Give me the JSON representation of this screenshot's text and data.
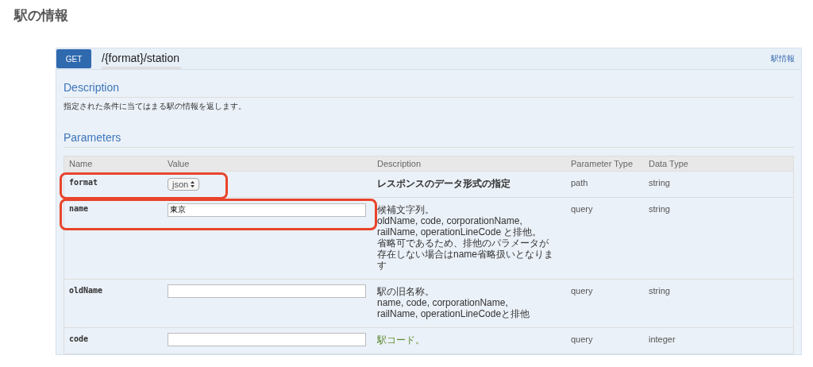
{
  "page_title": "駅の情報",
  "operation": {
    "method": "GET",
    "path": "/{format}/station",
    "tag": "駅情報",
    "description_heading": "Description",
    "description": "指定された条件に当てはまる駅の情報を返します。",
    "parameters_heading": "Parameters",
    "columns": [
      "Name",
      "Value",
      "Description",
      "Parameter Type",
      "Data Type"
    ],
    "parameters": [
      {
        "name": "format",
        "kind": "select",
        "value": "json",
        "description": [
          "レスポンスのデータ形式の指定"
        ],
        "bold": true,
        "link": false,
        "param_type": "path",
        "data_type": "string",
        "highlighted": true
      },
      {
        "name": "name",
        "kind": "text",
        "value": "東京",
        "description": [
          "候補文字列。",
          "oldName, code, corporationName,",
          "railName, operationLineCode と排他。",
          "省略可であるため、排他のパラメータが",
          "存在しない場合はname省略扱いとなりま",
          "す"
        ],
        "bold": false,
        "link": false,
        "param_type": "query",
        "data_type": "string",
        "highlighted": true
      },
      {
        "name": "oldName",
        "kind": "text",
        "description": [
          "駅の旧名称。",
          "name, code, corporationName,",
          "railName, operationLineCodeと排他"
        ],
        "bold": false,
        "link": false,
        "param_type": "query",
        "data_type": "string",
        "highlighted": false
      },
      {
        "name": "code",
        "kind": "text",
        "description": [
          "駅コード。"
        ],
        "bold": false,
        "link": true,
        "param_type": "query",
        "data_type": "integer",
        "highlighted": false
      }
    ]
  }
}
